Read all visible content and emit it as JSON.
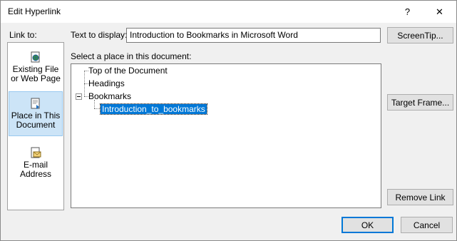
{
  "window": {
    "title": "Edit Hyperlink",
    "help_glyph": "?",
    "close_glyph": "✕"
  },
  "link_to": {
    "label": "Link to:",
    "items": [
      {
        "line1": "Existing File",
        "line2": "or Web Page",
        "icon": "web-page-icon",
        "selected": false
      },
      {
        "line1": "Place in This",
        "line2": "Document",
        "icon": "document-place-icon",
        "selected": true
      },
      {
        "line1": "E-mail",
        "line2": "Address",
        "icon": "email-icon",
        "selected": false
      }
    ]
  },
  "text_to_display": {
    "label": "Text to display:",
    "value": "Introduction to Bookmarks in Microsoft Word"
  },
  "place_label": "Select a place in this document:",
  "tree": {
    "nodes": [
      {
        "label": "Top of the Document"
      },
      {
        "label": "Headings"
      },
      {
        "label": "Bookmarks",
        "expanded": true
      },
      {
        "label": "Introduction_to_bookmarks",
        "selected": true
      }
    ]
  },
  "buttons": {
    "screentip": "ScreenTip...",
    "target_frame": "Target Frame...",
    "remove_link": "Remove Link",
    "ok": "OK",
    "cancel": "Cancel"
  },
  "colors": {
    "selection": "#0078d7",
    "nav_selected": "#cce4f7",
    "dialog_bg": "#f0f0f0"
  }
}
